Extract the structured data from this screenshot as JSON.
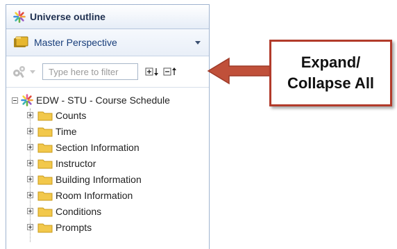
{
  "panel": {
    "title": "Universe outline",
    "perspective": "Master Perspective",
    "search_placeholder": "Type here to filter"
  },
  "icons": {
    "universe": "universe-star-icon",
    "perspective": "folder-stack-icon",
    "tool": "gears-icon",
    "expand": "expand-all-icon",
    "collapse": "collapse-all-icon",
    "folder": "folder-icon"
  },
  "tree": {
    "root": "EDW - STU - Course Schedule",
    "children": [
      "Counts",
      "Time",
      "Section Information",
      "Instructor",
      "Building Information",
      "Room Information",
      "Conditions",
      "Prompts"
    ]
  },
  "callout": {
    "line1": "Expand/",
    "line2": "Collapse All"
  },
  "colors": {
    "callout_border": "#b23b2b",
    "arrow": "#c0503a",
    "folder": "#f2c84b",
    "panel_border": "#9fb3cf"
  }
}
